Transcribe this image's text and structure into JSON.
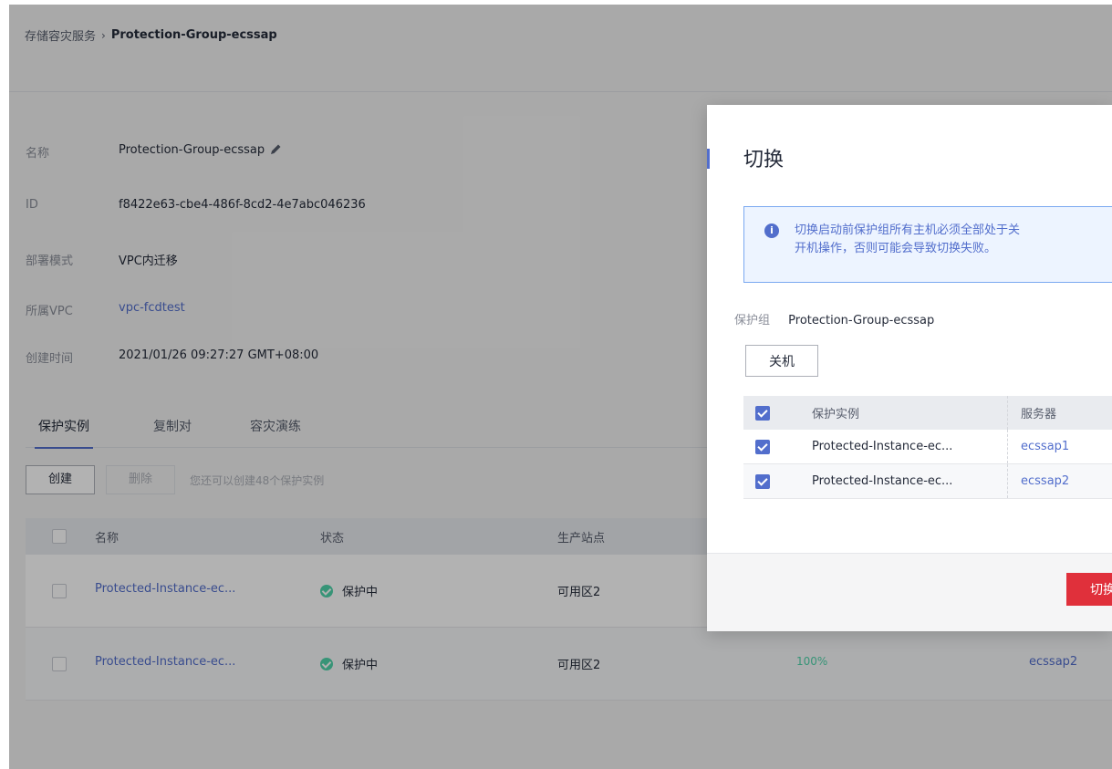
{
  "breadcrumb": {
    "parent": "存储容灾服务",
    "separator": "›",
    "current": "Protection-Group-ecssap"
  },
  "info": {
    "name_label": "名称",
    "name_value": "Protection-Group-ecssap",
    "id_label": "ID",
    "id_value": "f8422e63-cbe4-486f-8cd2-4e7abc046236",
    "mode_label": "部署模式",
    "mode_value": "VPC内迁移",
    "vpc_label": "所属VPC",
    "vpc_value": "vpc-fcdtest",
    "created_label": "创建时间",
    "created_value": "2021/01/26 09:27:27 GMT+08:00"
  },
  "tabs": [
    "保护实例",
    "复制对",
    "容灾演练"
  ],
  "toolbar": {
    "create_label": "创建",
    "delete_label": "删除",
    "quota_text": "您还可以创建48个保护实例"
  },
  "table": {
    "headers": [
      "名称",
      "状态",
      "生产站点"
    ],
    "rows": [
      {
        "name": "Protected-Instance-ec...",
        "status": "保护中",
        "site": "可用区2",
        "progress": "",
        "server": ""
      },
      {
        "name": "Protected-Instance-ec...",
        "status": "保护中",
        "site": "可用区2",
        "progress": "100%",
        "server": "ecssap2"
      }
    ]
  },
  "dialog": {
    "title": "切换",
    "alert_icon": "i",
    "alert_line1": "切换启动前保护组所有主机必须全部处于关",
    "alert_line2": "开机操作，否则可能会导致切换失败。",
    "pg_label": "保护组",
    "pg_value": "Protection-Group-ecssap",
    "shutdown_label": "关机",
    "table": {
      "headers": [
        "保护实例",
        "服务器"
      ],
      "rows": [
        {
          "instance": "Protected-Instance-ec...",
          "server": "ecssap1"
        },
        {
          "instance": "Protected-Instance-ec...",
          "server": "ecssap2"
        }
      ]
    },
    "confirm_label": "切换"
  },
  "colors": {
    "link": "#526ecc",
    "danger": "#e0303b",
    "success": "#50d4ab"
  }
}
